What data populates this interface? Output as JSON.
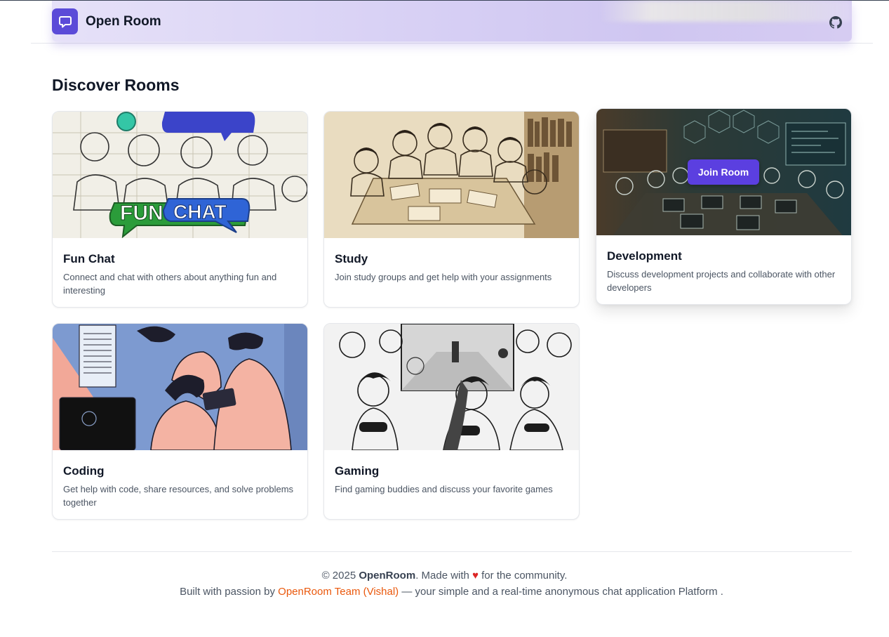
{
  "header": {
    "brand": "Open Room"
  },
  "page": {
    "title": "Discover Rooms"
  },
  "rooms": [
    {
      "title": "Fun Chat",
      "description": "Connect and chat with others about anything fun and interesting",
      "image_label": "FUN CHAT"
    },
    {
      "title": "Study",
      "description": "Join study groups and get help with your assignments"
    },
    {
      "title": "Development",
      "description": "Discuss development projects and collaborate with other developers",
      "action": "Join Room"
    },
    {
      "title": "Coding",
      "description": "Get help with code, share resources, and solve problems together"
    },
    {
      "title": "Gaming",
      "description": "Find gaming buddies and discuss your favorite games"
    }
  ],
  "footer": {
    "copyright": "© 2025",
    "brand": "OpenRoom",
    "made_with": ". Made with",
    "heart": "♥",
    "for_community": "for the community.",
    "built_with": "Built with passion by",
    "team": "OpenRoom Team (Vishal)",
    "tagline": "— your simple and a real-time anonymous chat application Platform ."
  },
  "colors": {
    "accent": "#5b3fe0",
    "heart": "#dc2626",
    "link": "#ea580c"
  },
  "icons": {
    "logo": "chat-bubble-icon",
    "github": "github-icon"
  }
}
